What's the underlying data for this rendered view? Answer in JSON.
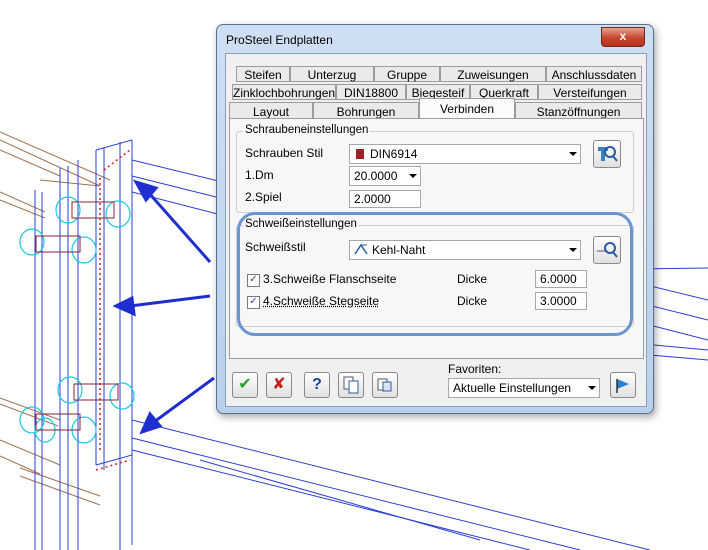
{
  "window": {
    "title": "ProSteel Endplatten",
    "close_glyph": "x"
  },
  "tabs": {
    "row1": [
      "Steifen",
      "Unterzug",
      "Gruppe",
      "Zuweisungen",
      "Anschlussdaten"
    ],
    "row2": [
      "Zinklochbohrungen",
      "DIN18800",
      "Biegesteif",
      "Querkraft",
      "Versteifungen"
    ],
    "row3": [
      "Layout",
      "Bohrungen",
      "Verbinden",
      "Stanzöffnungen"
    ],
    "active": "Verbinden"
  },
  "schrauben": {
    "group_label": "Schraubeneinstellungen",
    "stil_label": "Schrauben Stil",
    "stil_value": "DIN6914",
    "dm_label": "1.Dm",
    "dm_value": "20.0000",
    "spiel_label": "2.Spiel",
    "spiel_value": "2.0000"
  },
  "schweiss": {
    "group_label": "Schweißeinstellungen",
    "stil_label": "Schweißstil",
    "stil_value": "Kehl-Naht",
    "flansch_label": "3.Schweiße Flanschseite",
    "flansch_checked": true,
    "flansch_dicke_label": "Dicke",
    "flansch_dicke": "6.0000",
    "steg_label": "4.Schweiße Stegseite",
    "steg_checked": true,
    "steg_dicke_label": "Dicke",
    "steg_dicke": "3.0000"
  },
  "favoriten": {
    "label": "Favoriten:",
    "value": "Aktuelle Einstellungen"
  },
  "toolbar": {
    "ok_glyph": "✔",
    "cancel_glyph": "✘",
    "help_glyph": "?"
  },
  "colors": {
    "cad_blue": "#2a3fd6",
    "steel_brown": "#a07050",
    "bolt_cyan": "#17c8e6",
    "weld_red": "#d02020",
    "arrow_blue": "#1f2fcf",
    "highlight": "#6a95d3"
  }
}
